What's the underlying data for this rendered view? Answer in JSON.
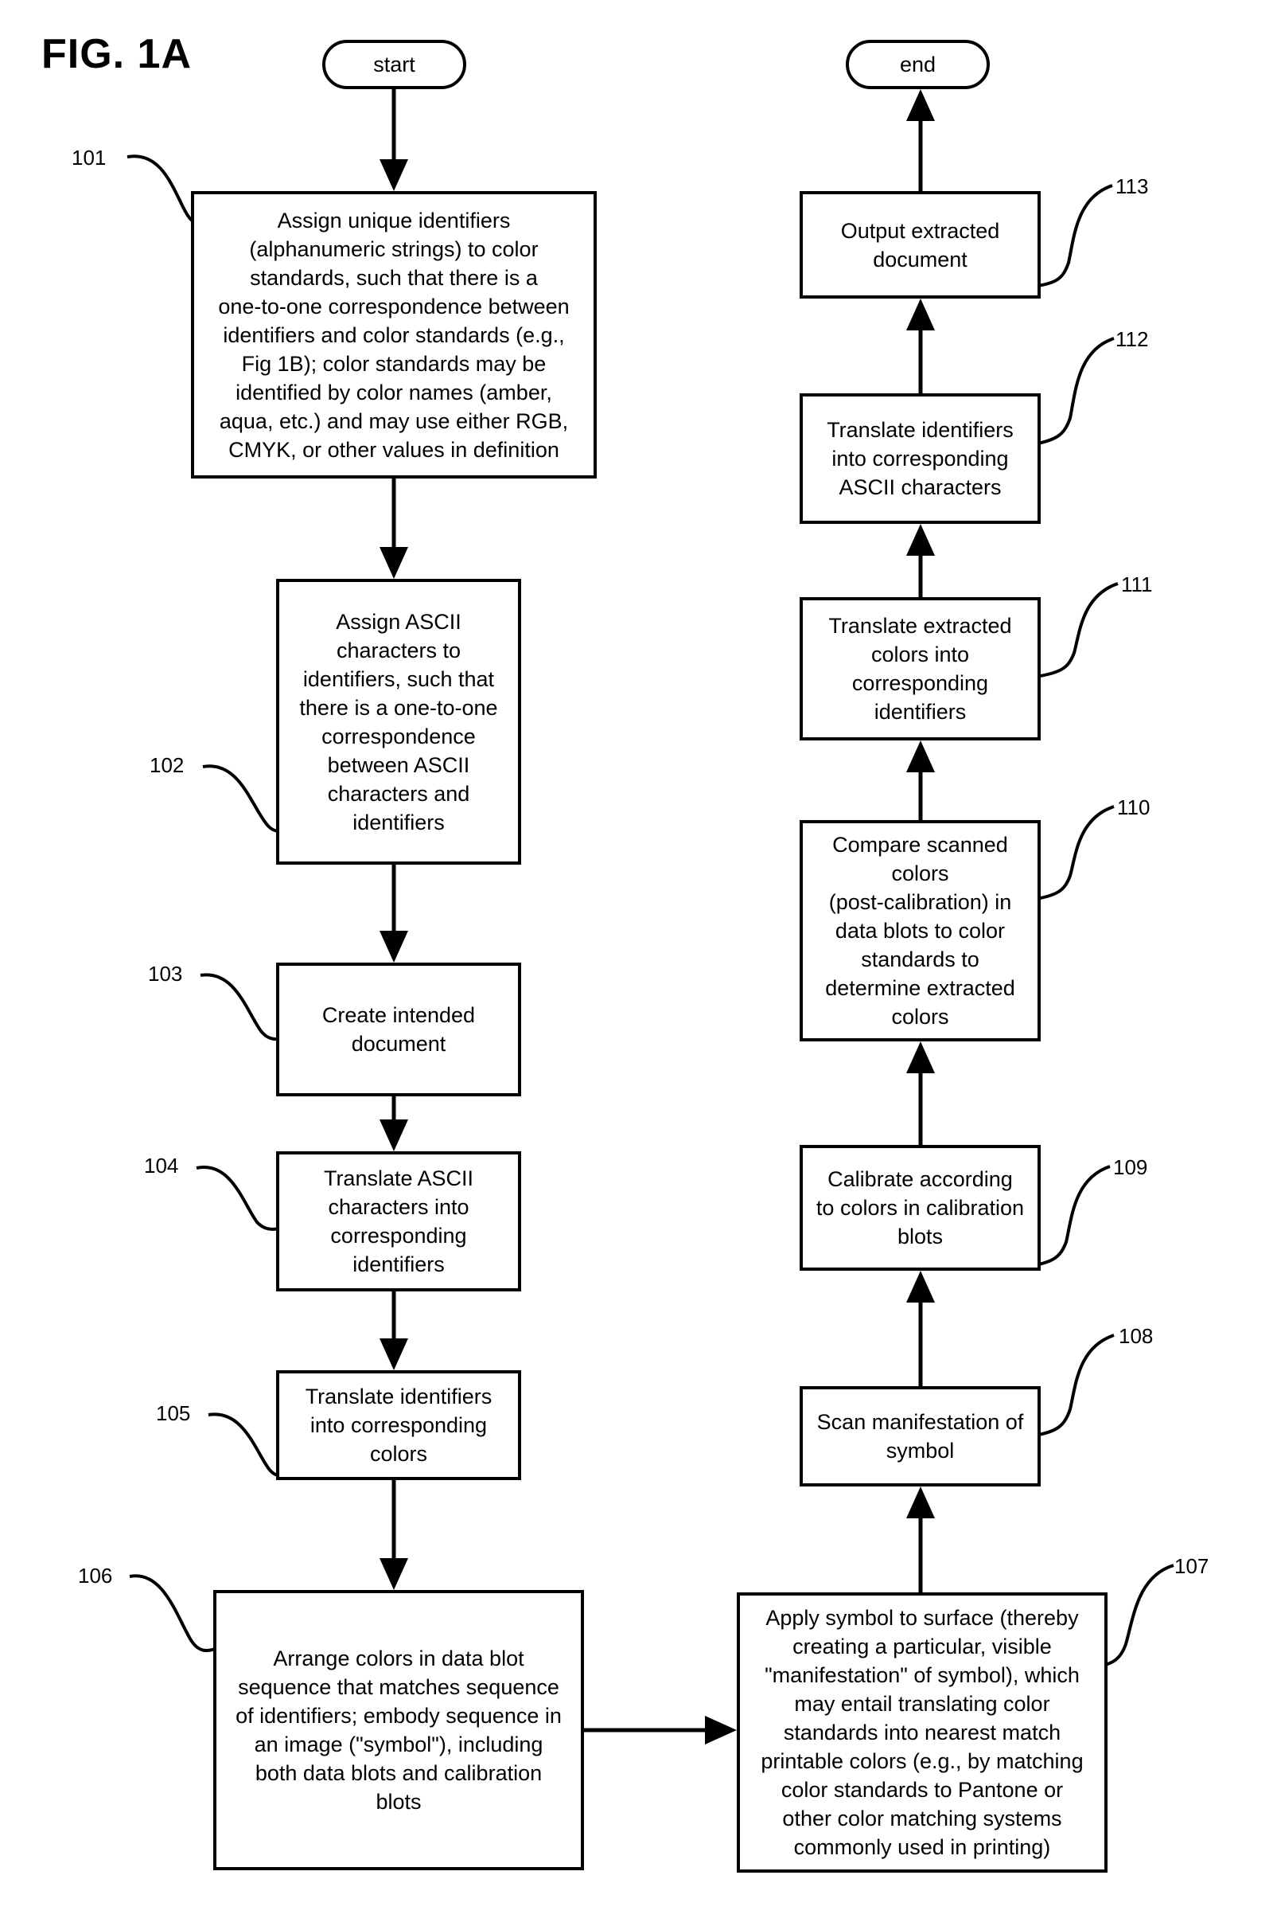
{
  "figure": {
    "title": "FIG. 1A"
  },
  "terminals": {
    "start": "start",
    "end": "end"
  },
  "steps": [
    {
      "ref": "101",
      "text": "Assign unique identifiers\n(alphanumeric strings) to color\nstandards, such that there is a\none-to-one correspondence between\nidentifiers and color standards (e.g.,\nFig 1B); color standards may  be\nidentified by color names (amber,\naqua, etc.) and may use either RGB,\nCMYK, or other values in definition"
    },
    {
      "ref": "102",
      "text": "Assign ASCII\ncharacters to\nidentifiers, such that\nthere is a one-to-one\ncorrespondence\nbetween ASCII\ncharacters and\nidentifiers"
    },
    {
      "ref": "103",
      "text": "Create intended\ndocument"
    },
    {
      "ref": "104",
      "text": "Translate ASCII\ncharacters into\ncorresponding\nidentifiers"
    },
    {
      "ref": "105",
      "text": "Translate identifiers\ninto corresponding\ncolors"
    },
    {
      "ref": "106",
      "text": "Arrange colors in data blot\nsequence that matches sequence\nof identifiers; embody sequence in\nan image (\"symbol\"), including\nboth data blots and calibration\nblots"
    },
    {
      "ref": "107",
      "text": "Apply symbol to surface (thereby\ncreating a particular, visible\n\"manifestation\" of symbol), which\nmay entail translating color\nstandards into nearest match\nprintable colors (e.g., by matching\ncolor standards to Pantone or\nother color matching systems\ncommonly used in printing)"
    },
    {
      "ref": "108",
      "text": "Scan manifestation of\nsymbol"
    },
    {
      "ref": "109",
      "text": "Calibrate according\nto colors in calibration\nblots"
    },
    {
      "ref": "110",
      "text": "Compare scanned\ncolors\n(post-calibration)  in\ndata blots to color\nstandards to\ndetermine extracted\ncolors"
    },
    {
      "ref": "111",
      "text": "Translate extracted\ncolors into\ncorresponding\nidentifiers"
    },
    {
      "ref": "112",
      "text": "Translate identifiers\ninto corresponding\nASCII characters"
    },
    {
      "ref": "113",
      "text": "Output extracted\ndocument"
    }
  ],
  "flow": [
    "start",
    "101",
    "102",
    "103",
    "104",
    "105",
    "106",
    "107",
    "108",
    "109",
    "110",
    "111",
    "112",
    "113",
    "end"
  ]
}
